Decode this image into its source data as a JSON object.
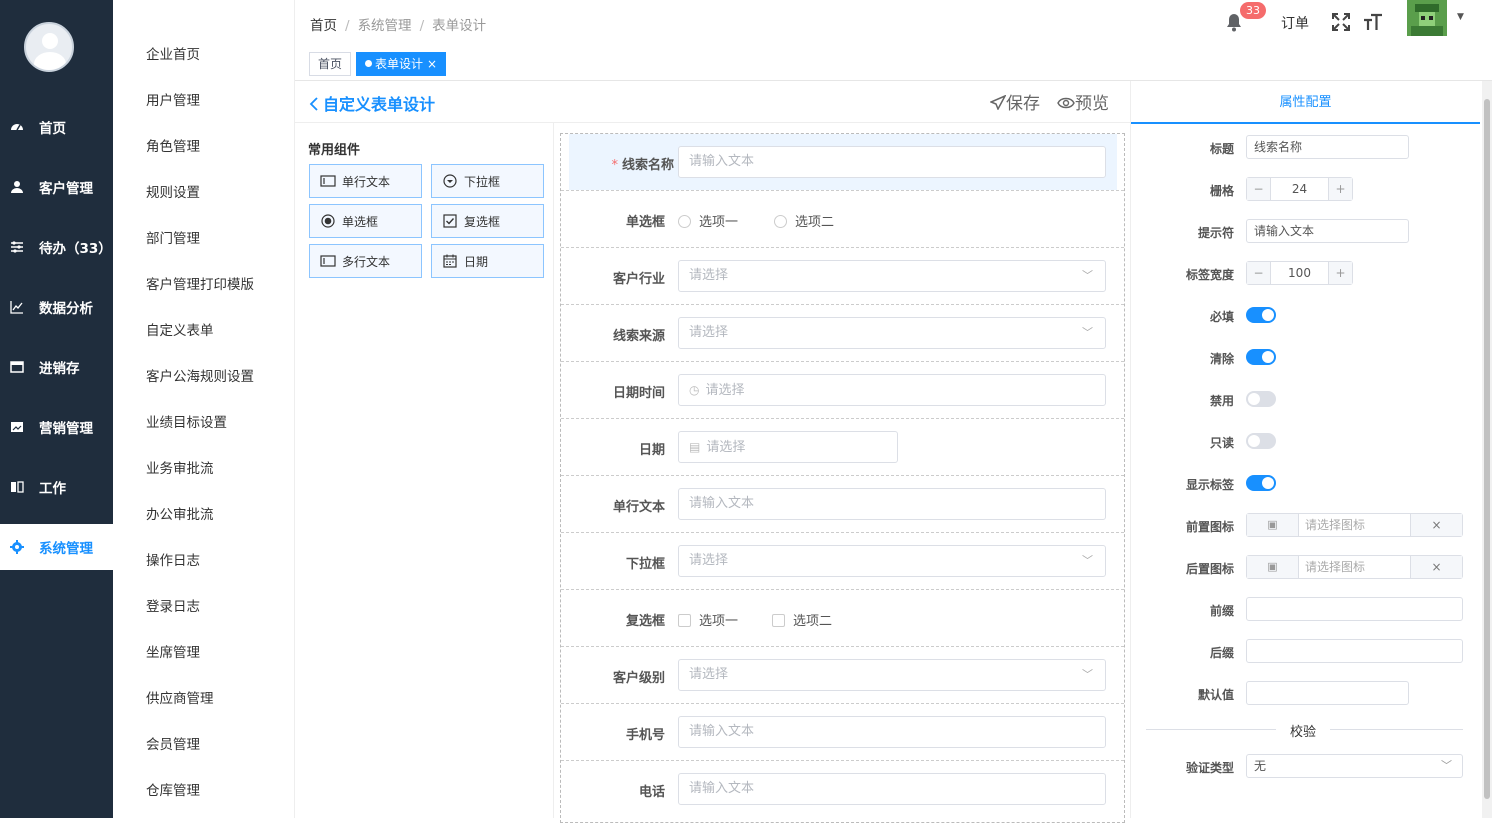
{
  "nav": {
    "items": [
      {
        "label": "首页",
        "icon": "dashboard-icon"
      },
      {
        "label": "客户管理",
        "icon": "user-icon"
      },
      {
        "label": "待办（33）",
        "icon": "sliders-icon"
      },
      {
        "label": "数据分析",
        "icon": "chart-icon"
      },
      {
        "label": "进销存",
        "icon": "window-icon"
      },
      {
        "label": "营销管理",
        "icon": "image-icon"
      },
      {
        "label": "工作",
        "icon": "book-icon"
      },
      {
        "label": "系统管理",
        "icon": "gear-icon",
        "active": true
      }
    ]
  },
  "subnav": {
    "items": [
      "企业首页",
      "用户管理",
      "角色管理",
      "规则设置",
      "部门管理",
      "客户管理打印模版",
      "自定义表单",
      "客户公海规则设置",
      "业绩目标设置",
      "业务审批流",
      "办公审批流",
      "操作日志",
      "登录日志",
      "坐席管理",
      "供应商管理",
      "会员管理",
      "仓库管理"
    ]
  },
  "header": {
    "breadcrumb": [
      "首页",
      "系统管理",
      "表单设计"
    ],
    "notification_count": "33",
    "order_label": "订单"
  },
  "tabs": [
    {
      "label": "首页"
    },
    {
      "label": "表单设计",
      "active": true,
      "close": "×"
    }
  ],
  "designer": {
    "title": "自定义表单设计",
    "save_label": "保存",
    "preview_label": "预览",
    "palette_title": "常用组件",
    "palette": [
      "单行文本",
      "下拉框",
      "单选框",
      "复选框",
      "多行文本",
      "日期"
    ],
    "fields": [
      {
        "label": "线索名称",
        "type": "text",
        "placeholder": "请输入文本",
        "required": true,
        "selected": true
      },
      {
        "label": "单选框",
        "type": "radio",
        "options": [
          "选项一",
          "选项二"
        ]
      },
      {
        "label": "客户行业",
        "type": "select",
        "placeholder": "请选择"
      },
      {
        "label": "线索来源",
        "type": "select",
        "placeholder": "请选择"
      },
      {
        "label": "日期时间",
        "type": "datetime",
        "placeholder": "请选择"
      },
      {
        "label": "日期",
        "type": "date",
        "placeholder": "请选择"
      },
      {
        "label": "单行文本",
        "type": "text",
        "placeholder": "请输入文本"
      },
      {
        "label": "下拉框",
        "type": "select",
        "placeholder": "请选择"
      },
      {
        "label": "复选框",
        "type": "checkbox",
        "options": [
          "选项一",
          "选项二"
        ]
      },
      {
        "label": "客户级别",
        "type": "select",
        "placeholder": "请选择"
      },
      {
        "label": "手机号",
        "type": "text",
        "placeholder": "请输入文本"
      },
      {
        "label": "电话",
        "type": "text",
        "placeholder": "请输入文本"
      }
    ]
  },
  "props": {
    "tab_label": "属性配置",
    "title_label": "标题",
    "title_value": "线索名称",
    "grid_label": "栅格",
    "grid_value": "24",
    "placeholder_label": "提示符",
    "placeholder_value": "请输入文本",
    "label_width_label": "标签宽度",
    "label_width_value": "100",
    "required_label": "必填",
    "required_on": true,
    "clearable_label": "清除",
    "clearable_on": true,
    "disabled_label": "禁用",
    "disabled_on": false,
    "readonly_label": "只读",
    "readonly_on": false,
    "show_label_label": "显示标签",
    "show_label_on": true,
    "prefix_icon_label": "前置图标",
    "prefix_icon_placeholder": "请选择图标",
    "suffix_icon_label": "后置图标",
    "suffix_icon_placeholder": "请选择图标",
    "prefix_label": "前缀",
    "suffix_label": "后缀",
    "default_label": "默认值",
    "validate_title": "校验",
    "validate_type_label": "验证类型",
    "validate_type_value": "无",
    "minus": "−",
    "plus": "+",
    "clear": "×"
  },
  "colors": {
    "primary": "#1890ff",
    "nav_bg": "#1f2d3d",
    "badge": "#f56c6c"
  }
}
